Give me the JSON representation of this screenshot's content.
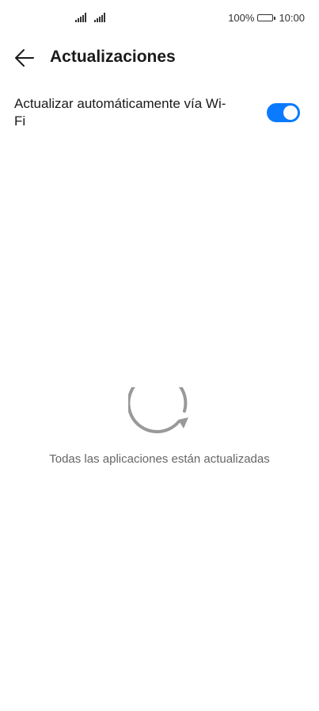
{
  "status_bar": {
    "battery_percent": "100%",
    "time": "10:00",
    "icons": [
      "signal-icon",
      "signal-icon",
      "battery-icon"
    ]
  },
  "header": {
    "back_icon": "arrow-left-icon",
    "title": "Actualizaciones"
  },
  "settings": {
    "auto_update_label": "Actualizar automáticamente vía Wi-Fi",
    "auto_update_enabled": true,
    "toggle_color": "#0a7aff"
  },
  "empty_state": {
    "icon": "refresh-icon",
    "message": "Todas las aplicaciones están actualizadas"
  }
}
